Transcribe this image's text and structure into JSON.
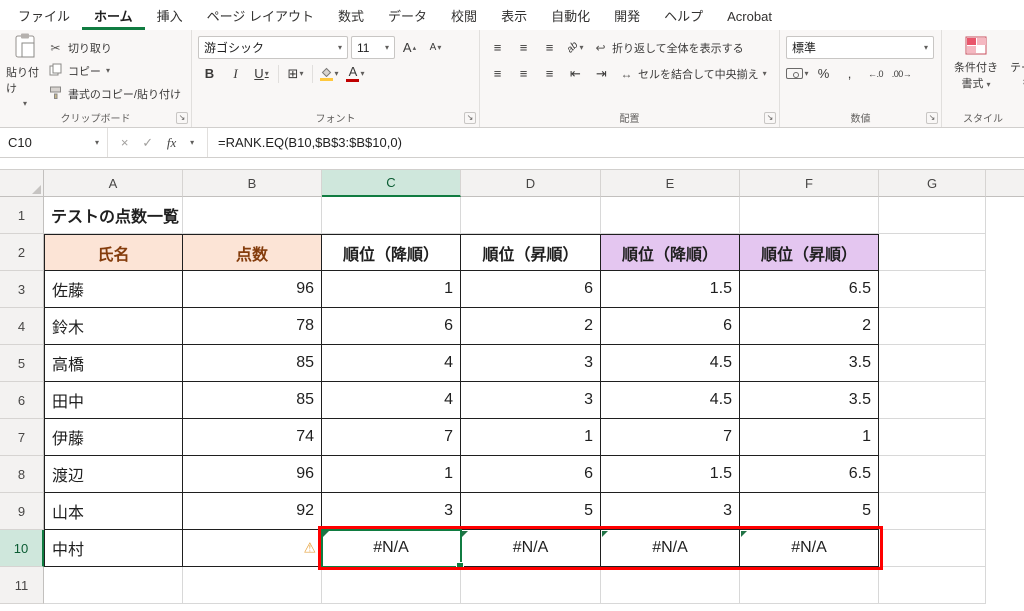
{
  "menu": {
    "tabs": [
      {
        "key": "file",
        "label": "ファイル",
        "active": false
      },
      {
        "key": "home",
        "label": "ホーム",
        "active": true
      },
      {
        "key": "insert",
        "label": "挿入",
        "active": false
      },
      {
        "key": "page-layout",
        "label": "ページ レイアウト",
        "active": false
      },
      {
        "key": "formulas",
        "label": "数式",
        "active": false
      },
      {
        "key": "data",
        "label": "データ",
        "active": false
      },
      {
        "key": "review",
        "label": "校閲",
        "active": false
      },
      {
        "key": "view",
        "label": "表示",
        "active": false
      },
      {
        "key": "automate",
        "label": "自動化",
        "active": false
      },
      {
        "key": "developer",
        "label": "開発",
        "active": false
      },
      {
        "key": "help",
        "label": "ヘルプ",
        "active": false
      },
      {
        "key": "acrobat",
        "label": "Acrobat",
        "active": false
      }
    ]
  },
  "ribbon": {
    "clipboard": {
      "paste": "貼り付け",
      "cut": "切り取り",
      "copy": "コピー",
      "format_painter": "書式のコピー/貼り付け",
      "group_label": "クリップボード"
    },
    "font": {
      "font_name": "游ゴシック",
      "font_size": "11",
      "bold": "B",
      "italic": "I",
      "underline": "U",
      "grow_letter": "A",
      "shrink_letter": "A",
      "font_color_letter": "A",
      "group_label": "フォント"
    },
    "alignment": {
      "orientation": "ab",
      "wrap_text": "折り返して全体を表示する",
      "merge_center": "セルを結合して中央揃え",
      "group_label": "配置"
    },
    "number": {
      "format": "標準",
      "percent": "%",
      "comma": ",",
      "increase_decimal": "←.0",
      "decrease_decimal": ".00→",
      "group_label": "数値"
    },
    "styles": {
      "conditional_line1": "条件付き",
      "conditional_line2": "書式",
      "table_line1": "テーブルとして",
      "table_line2": "書式設定",
      "group_label": "スタイル"
    }
  },
  "formula_bar": {
    "name_box": "C10",
    "formula": "=RANK.EQ(B10,$B$3:$B$10,0)",
    "fx": "fx"
  },
  "icons": {
    "dropdown": "▾",
    "up_triangle": "▴",
    "scissors": "✂",
    "close": "×",
    "check": "✓",
    "warning": "⚠",
    "launcher": "↘",
    "borders": "⊞",
    "wrap": "↩",
    "bars": "≡",
    "merge_arrows": "↔",
    "indent_left": "⇤",
    "indent_right": "⇥"
  },
  "sheet": {
    "col_headers": [
      "A",
      "B",
      "C",
      "D",
      "E",
      "F",
      "G"
    ],
    "row_headers": [
      "1",
      "2",
      "3",
      "4",
      "5",
      "6",
      "7",
      "8",
      "9",
      "10",
      "11"
    ],
    "selected_col": "C",
    "selected_row": 10,
    "rows": [
      {
        "n": 1,
        "cells": [
          {
            "col": "A",
            "text": "テストの点数一覧",
            "type": "title"
          }
        ]
      },
      {
        "n": 2,
        "cells": [
          {
            "col": "A",
            "text": "氏名",
            "type": "hpeach"
          },
          {
            "col": "B",
            "text": "点数",
            "type": "hpeach"
          },
          {
            "col": "C",
            "text": "順位（降順）",
            "type": "hwhite"
          },
          {
            "col": "D",
            "text": "順位（昇順）",
            "type": "hwhite"
          },
          {
            "col": "E",
            "text": "順位（降順）",
            "type": "hpurple"
          },
          {
            "col": "F",
            "text": "順位（昇順）",
            "type": "hpurple"
          }
        ]
      },
      {
        "n": 3,
        "cells": [
          {
            "col": "A",
            "text": "佐藤",
            "type": "name"
          },
          {
            "col": "B",
            "text": "96",
            "type": "num"
          },
          {
            "col": "C",
            "text": "1",
            "type": "num"
          },
          {
            "col": "D",
            "text": "6",
            "type": "num"
          },
          {
            "col": "E",
            "text": "1.5",
            "type": "num"
          },
          {
            "col": "F",
            "text": "6.5",
            "type": "num"
          }
        ]
      },
      {
        "n": 4,
        "cells": [
          {
            "col": "A",
            "text": "鈴木",
            "type": "name"
          },
          {
            "col": "B",
            "text": "78",
            "type": "num"
          },
          {
            "col": "C",
            "text": "6",
            "type": "num"
          },
          {
            "col": "D",
            "text": "2",
            "type": "num"
          },
          {
            "col": "E",
            "text": "6",
            "type": "num"
          },
          {
            "col": "F",
            "text": "2",
            "type": "num"
          }
        ]
      },
      {
        "n": 5,
        "cells": [
          {
            "col": "A",
            "text": "高橋",
            "type": "name"
          },
          {
            "col": "B",
            "text": "85",
            "type": "num"
          },
          {
            "col": "C",
            "text": "4",
            "type": "num"
          },
          {
            "col": "D",
            "text": "3",
            "type": "num"
          },
          {
            "col": "E",
            "text": "4.5",
            "type": "num"
          },
          {
            "col": "F",
            "text": "3.5",
            "type": "num"
          }
        ]
      },
      {
        "n": 6,
        "cells": [
          {
            "col": "A",
            "text": "田中",
            "type": "name"
          },
          {
            "col": "B",
            "text": "85",
            "type": "num"
          },
          {
            "col": "C",
            "text": "4",
            "type": "num"
          },
          {
            "col": "D",
            "text": "3",
            "type": "num"
          },
          {
            "col": "E",
            "text": "4.5",
            "type": "num"
          },
          {
            "col": "F",
            "text": "3.5",
            "type": "num"
          }
        ]
      },
      {
        "n": 7,
        "cells": [
          {
            "col": "A",
            "text": "伊藤",
            "type": "name"
          },
          {
            "col": "B",
            "text": "74",
            "type": "num"
          },
          {
            "col": "C",
            "text": "7",
            "type": "num"
          },
          {
            "col": "D",
            "text": "1",
            "type": "num"
          },
          {
            "col": "E",
            "text": "7",
            "type": "num"
          },
          {
            "col": "F",
            "text": "1",
            "type": "num"
          }
        ]
      },
      {
        "n": 8,
        "cells": [
          {
            "col": "A",
            "text": "渡辺",
            "type": "name"
          },
          {
            "col": "B",
            "text": "96",
            "type": "num"
          },
          {
            "col": "C",
            "text": "1",
            "type": "num"
          },
          {
            "col": "D",
            "text": "6",
            "type": "num"
          },
          {
            "col": "E",
            "text": "1.5",
            "type": "num"
          },
          {
            "col": "F",
            "text": "6.5",
            "type": "num"
          }
        ]
      },
      {
        "n": 9,
        "cells": [
          {
            "col": "A",
            "text": "山本",
            "type": "name"
          },
          {
            "col": "B",
            "text": "92",
            "type": "num"
          },
          {
            "col": "C",
            "text": "3",
            "type": "num"
          },
          {
            "col": "D",
            "text": "5",
            "type": "num"
          },
          {
            "col": "E",
            "text": "3",
            "type": "num"
          },
          {
            "col": "F",
            "text": "5",
            "type": "num"
          }
        ]
      },
      {
        "n": 10,
        "cells": [
          {
            "col": "A",
            "text": "中村",
            "type": "name"
          },
          {
            "col": "B",
            "text": "",
            "type": "num",
            "warning": true
          },
          {
            "col": "C",
            "text": "#N/A",
            "type": "err"
          },
          {
            "col": "D",
            "text": "#N/A",
            "type": "err"
          },
          {
            "col": "E",
            "text": "#N/A",
            "type": "err"
          },
          {
            "col": "F",
            "text": "#N/A",
            "type": "err"
          }
        ]
      },
      {
        "n": 11,
        "cells": []
      }
    ]
  },
  "selection": {
    "active_cell": "C10",
    "error_cells": [
      "C10",
      "D10",
      "E10",
      "F10"
    ]
  },
  "colors": {
    "accent_green": "#107C41",
    "error_border": "#FF0000",
    "header_peach": "#FCE4D6",
    "header_peach_text": "#843C0C",
    "header_purple": "#E4C6F0",
    "selected_header_bg": "#CFE7DC",
    "grid_line": "#D8D8D8",
    "table_border": "#1F1F1F"
  }
}
